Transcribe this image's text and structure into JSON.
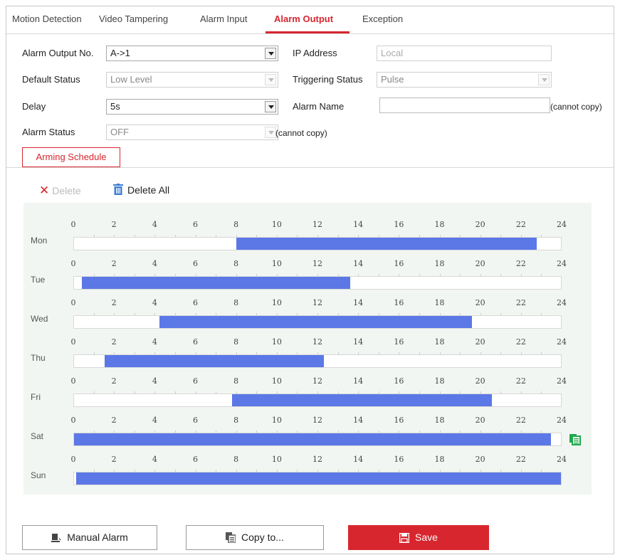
{
  "tabs": [
    {
      "label": "Motion Detection",
      "active": false
    },
    {
      "label": "Video Tampering",
      "active": false
    },
    {
      "label": "Alarm Input",
      "active": false
    },
    {
      "label": "Alarm Output",
      "active": true
    },
    {
      "label": "Exception",
      "active": false
    }
  ],
  "form": {
    "alarm_output_no": {
      "label": "Alarm Output No.",
      "value": "A->1"
    },
    "default_status": {
      "label": "Default Status",
      "value": "Low Level"
    },
    "delay": {
      "label": "Delay",
      "value": "5s"
    },
    "alarm_status": {
      "label": "Alarm Status",
      "value": "OFF",
      "note": "(cannot copy)"
    },
    "ip_address": {
      "label": "IP Address",
      "value": "Local"
    },
    "triggering_status": {
      "label": "Triggering Status",
      "value": "Pulse"
    },
    "alarm_name": {
      "label": "Alarm Name",
      "value": "",
      "note": "(cannot copy)"
    }
  },
  "arming_schedule_label": "Arming Schedule",
  "toolbar": {
    "delete_label": "Delete",
    "delete_all_label": "Delete All"
  },
  "schedule": {
    "ticks": [
      "0",
      "2",
      "4",
      "6",
      "8",
      "10",
      "12",
      "14",
      "16",
      "18",
      "20",
      "22",
      "24"
    ],
    "days": [
      {
        "name": "Mon",
        "segments": [
          [
            8,
            22.8
          ]
        ]
      },
      {
        "name": "Tue",
        "segments": [
          [
            0.4,
            13.6
          ]
        ]
      },
      {
        "name": "Wed",
        "segments": [
          [
            4.2,
            19.6
          ]
        ]
      },
      {
        "name": "Thu",
        "segments": [
          [
            1.5,
            12.3
          ]
        ]
      },
      {
        "name": "Fri",
        "segments": [
          [
            7.8,
            20.6
          ]
        ]
      },
      {
        "name": "Sat",
        "segments": [
          [
            0,
            23.5
          ]
        ]
      },
      {
        "name": "Sun",
        "segments": [
          [
            0.1,
            24
          ]
        ]
      }
    ],
    "segment_color": "#5b78e6"
  },
  "buttons": {
    "manual_alarm": "Manual Alarm",
    "copy_to": "Copy to...",
    "save": "Save"
  },
  "colors": {
    "accent": "#d8262e",
    "schedule_bar": "#5b78e6",
    "copy_icon": "#1ea84a"
  }
}
